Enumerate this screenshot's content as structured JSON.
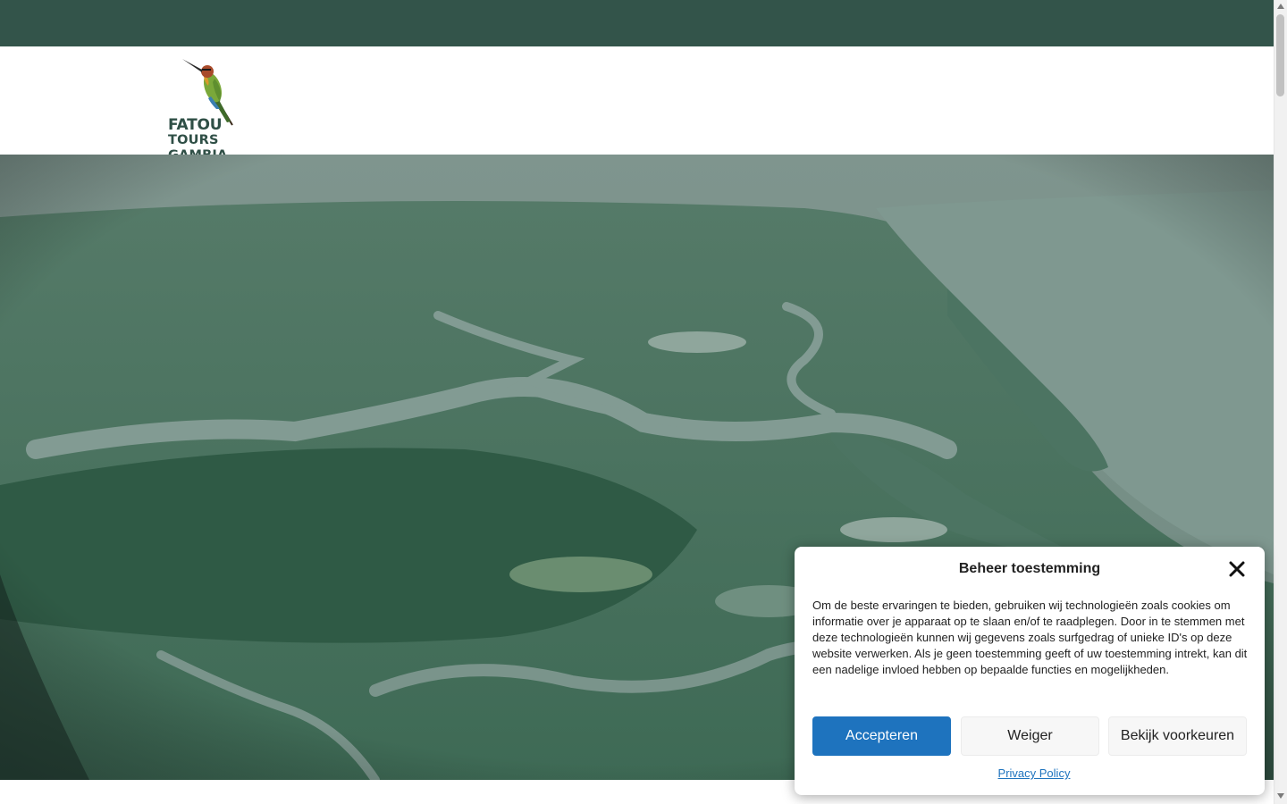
{
  "colors": {
    "topbar": "#33544a",
    "logo_text": "#2f4f46",
    "accept_button": "#1e73be",
    "link": "#1e73be"
  },
  "logo": {
    "line1": "FATOU",
    "line2": "TOURS GAMBIA",
    "icon": "bee-eater-bird-icon"
  },
  "hero": {
    "image": "aerial river delta landscape"
  },
  "consent": {
    "title": "Beheer toestemming",
    "close_icon": "close-icon",
    "body": "Om de beste ervaringen te bieden, gebruiken wij technologieën zoals cookies om informatie over je apparaat op te slaan en/of te raadplegen. Door in te stemmen met deze technologieën kunnen wij gegevens zoals surfgedrag of unieke ID's op deze website verwerken. Als je geen toestemming geeft of uw toestemming intrekt, kan dit een nadelige invloed hebben op bepaalde functies en mogelijkheden.",
    "accept_label": "Accepteren",
    "deny_label": "Weiger",
    "preferences_label": "Bekijk voorkeuren",
    "privacy_link": "Privacy Policy"
  }
}
